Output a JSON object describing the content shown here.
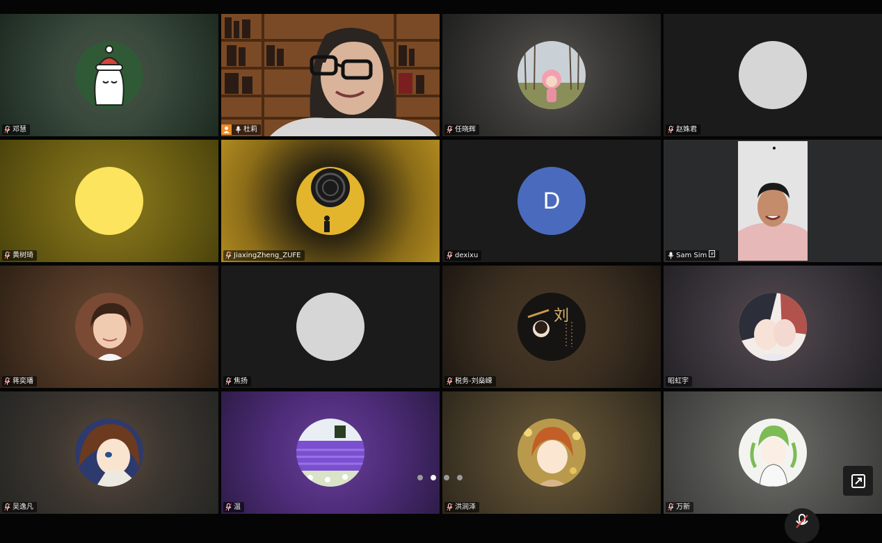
{
  "meeting": {
    "participants": [
      {
        "name": "邓慧",
        "avatar": "character-santa-hat-icon",
        "muted": true
      },
      {
        "name": "杜莉",
        "avatar": "camera-video-bookshelf",
        "muted": false,
        "host": true
      },
      {
        "name": "任晓辉",
        "avatar": "photo-doll-in-park",
        "muted": true
      },
      {
        "name": "赵姝君",
        "avatar": "blank-light-gray-avatar",
        "muted": true
      },
      {
        "name": "黄树琦",
        "avatar": "yellow-circle-avatar",
        "muted": true
      },
      {
        "name": "JiaxingZheng_ZUFE",
        "avatar": "ornament-on-yellow-avatar",
        "muted": true
      },
      {
        "name": "dexixu",
        "avatar": "letter-avatar",
        "letter": "D",
        "muted": true
      },
      {
        "name": "Sam Sim",
        "avatar": "camera-video-man",
        "muted": false,
        "sharing": true
      },
      {
        "name": "蒋奕璠",
        "avatar": "photo-boy-portrait",
        "muted": true
      },
      {
        "name": "焦扬",
        "avatar": "blank-light-gray-avatar",
        "muted": true
      },
      {
        "name": "税务-刘燊嵘",
        "avatar": "calligraphy-avatar",
        "muted": true
      },
      {
        "name": "昭虹宇",
        "avatar": "anime-couple-avatar",
        "muted": false
      },
      {
        "name": "吴逸凡",
        "avatar": "anime-detective-avatar",
        "muted": true
      },
      {
        "name": "温",
        "avatar": "lavender-field-photo",
        "muted": true
      },
      {
        "name": "洪润泽",
        "avatar": "anime-child-flowers-avatar",
        "muted": true
      },
      {
        "name": "万新",
        "avatar": "anime-green-hair-avatar",
        "muted": true
      }
    ],
    "pager": {
      "pages": 4,
      "current": 2
    },
    "controls": {
      "expand": "expand-icon",
      "mute": "muted-mic-icon"
    }
  }
}
